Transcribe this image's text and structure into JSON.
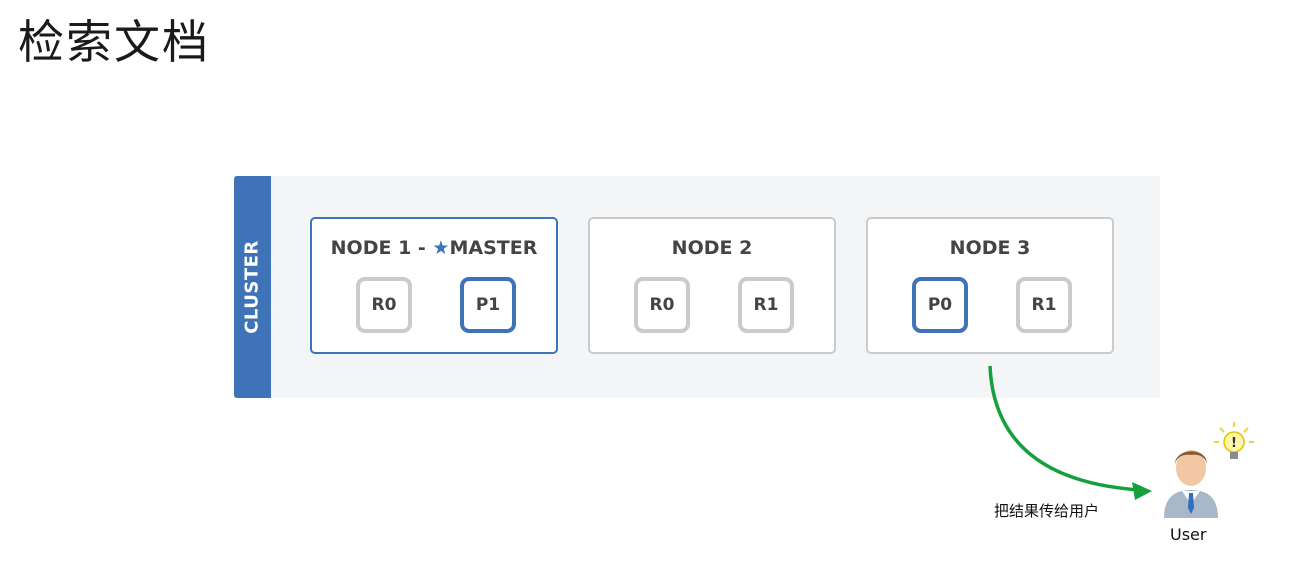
{
  "page": {
    "title": "检索文档"
  },
  "cluster": {
    "label": "CLUSTER",
    "nodes": [
      {
        "name": "NODE 1 - ",
        "role": "MASTER",
        "shards": [
          {
            "label": "R0",
            "primary": false
          },
          {
            "label": "P1",
            "primary": true
          }
        ]
      },
      {
        "name": "NODE 2",
        "shards": [
          {
            "label": "R0",
            "primary": false
          },
          {
            "label": "R1",
            "primary": false
          }
        ]
      },
      {
        "name": "NODE 3",
        "shards": [
          {
            "label": "P0",
            "primary": true
          },
          {
            "label": "R1",
            "primary": false
          }
        ]
      }
    ]
  },
  "flow": {
    "label": "把结果传给用户"
  },
  "user": {
    "label": "User"
  },
  "colors": {
    "accent": "#3f73b7",
    "arrow": "#14a03c",
    "border": "#c9cbcd",
    "panel": "#f4f5f6"
  },
  "icons": {
    "master": "star-icon",
    "user": "user-icon",
    "idea": "lightbulb-icon"
  }
}
